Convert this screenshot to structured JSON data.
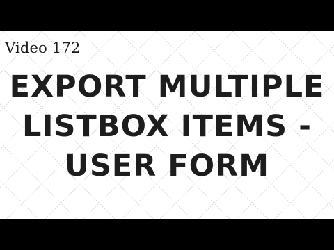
{
  "video_label": "Video 172",
  "title_lines": [
    "EXPORT MULTIPLE",
    "LISTBOX ITEMS -",
    "USER FORM"
  ],
  "colors": {
    "letterbox": "#000000",
    "background": "#ffffff",
    "pattern_line": "#d9d9d9",
    "text": "#1d1d1d"
  }
}
